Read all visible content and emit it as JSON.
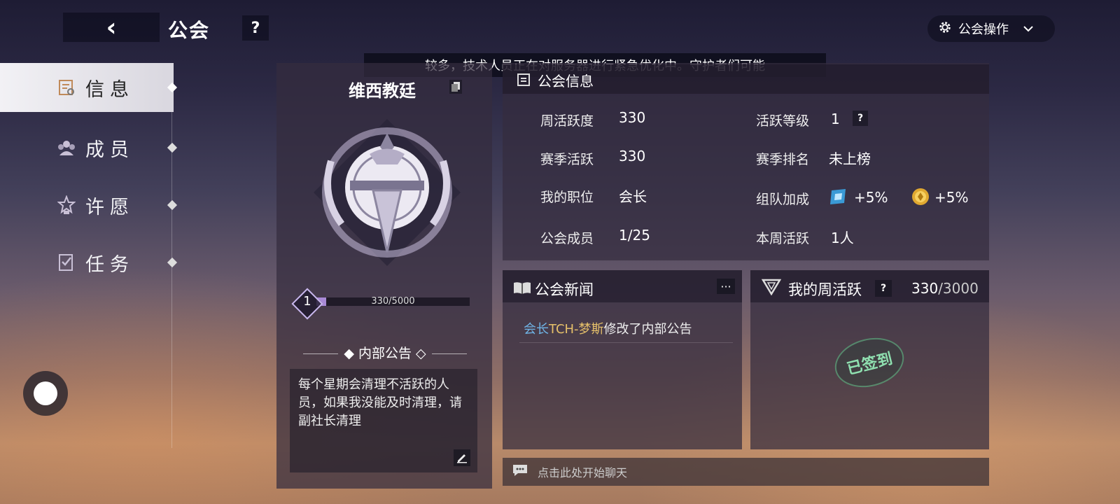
{
  "header": {
    "back_icon": "chevron-left-icon",
    "title": "公会",
    "help_label": "?",
    "ops_label": "公会操作"
  },
  "marquee": {
    "text": "较多，技术人员正在对服务器进行紧急优化中。守护者们可能"
  },
  "sidebar": {
    "items": [
      {
        "label": "信息",
        "icon": "info-icon",
        "active": true
      },
      {
        "label": "成员",
        "icon": "members-icon",
        "active": false
      },
      {
        "label": "许愿",
        "icon": "wish-icon",
        "active": false
      },
      {
        "label": "任务",
        "icon": "task-icon",
        "active": false
      }
    ]
  },
  "guild": {
    "name": "维西教廷",
    "level": "1",
    "exp_text": "330/5000",
    "exp_fraction": 0.066,
    "notice_title": "内部公告",
    "notice_text": "每个星期会清理不活跃的人员，如果我没能及时清理，请副社长清理"
  },
  "info": {
    "title": "公会信息",
    "weekly_activity_label": "周活跃度",
    "weekly_activity_value": "330",
    "activity_level_label": "活跃等级",
    "activity_level_value": "1",
    "activity_level_help": "?",
    "season_activity_label": "赛季活跃",
    "season_activity_value": "330",
    "season_rank_label": "赛季排名",
    "season_rank_value": "未上榜",
    "position_label": "我的职位",
    "position_value": "会长",
    "team_bonus_label": "组队加成",
    "bonus1": "+5%",
    "bonus2": "+5%",
    "members_label": "公会成员",
    "members_value": "1/25",
    "weekly_active_label": "本周活跃",
    "weekly_active_value": "1人"
  },
  "news": {
    "title": "公会新闻",
    "more_label": "···",
    "prefix": "会长",
    "user": "TCH-梦斯",
    "action": "修改了内部公告"
  },
  "weekly": {
    "title": "我的周活跃",
    "help": "?",
    "current": "330",
    "total": "/3000",
    "stamp_text": "已签到"
  },
  "chat": {
    "placeholder": "点击此处开始聊天"
  },
  "colors": {
    "accent": "#a98ad6",
    "news_prefix": "#6fb4e6",
    "news_user": "#e6c06a",
    "stamp": "#8fe0b0"
  }
}
